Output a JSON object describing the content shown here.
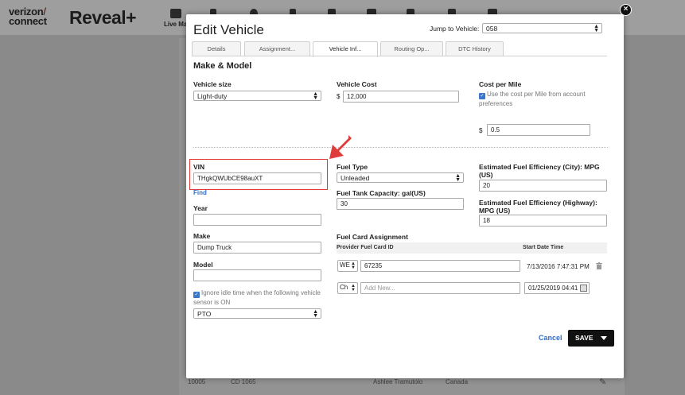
{
  "app": {
    "brand_line1": "verizon",
    "brand_tick": "/",
    "brand_line2": "connect",
    "product": "Reveal+",
    "nav_live_map": "Live Ma",
    "bg_row": {
      "id": "10005",
      "code": "CD 1065",
      "name": "Ashlee Tramutolo",
      "country": "Canada"
    }
  },
  "modal": {
    "title": "Edit Vehicle",
    "jump_label": "Jump to Vehicle:",
    "jump_value": "058",
    "tabs": [
      {
        "label": "Details"
      },
      {
        "label": "Assignment..."
      },
      {
        "label": "Vehicle Inf..."
      },
      {
        "label": "Routing Op..."
      },
      {
        "label": "DTC History"
      }
    ],
    "section_title": "Make & Model",
    "vehicle_size": {
      "label": "Vehicle size",
      "value": "Light-duty"
    },
    "vehicle_cost": {
      "label": "Vehicle Cost",
      "prefix": "$",
      "value": "12,000"
    },
    "cost_per_mile": {
      "label": "Cost per Mile",
      "checkbox_text": "Use the cost per Mile from account preferences",
      "prefix": "$",
      "value": "0.5"
    },
    "vin": {
      "label": "VIN",
      "value": "THgkQWUbCE98auXT",
      "find_link": "Find"
    },
    "year": {
      "label": "Year",
      "value": ""
    },
    "make": {
      "label": "Make",
      "value": "Dump Truck"
    },
    "model": {
      "label": "Model",
      "value": ""
    },
    "idle": {
      "checkbox_text": "Ignore idle time when the following vehicle sensor is ON",
      "sensor_value": "PTO"
    },
    "fuel_type": {
      "label": "Fuel Type",
      "value": "Unleaded"
    },
    "fuel_tank": {
      "label": "Fuel Tank Capacity: gal(US)",
      "value": "30"
    },
    "eff_city": {
      "label": "Estimated Fuel Efficiency (City): MPG (US)",
      "value": "20"
    },
    "eff_highway": {
      "label": "Estimated Fuel Efficiency (Highway): MPG (US)",
      "value": "18"
    },
    "fuel_card": {
      "label": "Fuel Card Assignment",
      "col_provider": "Provider Fuel Card ID",
      "col_start": "Start Date Time",
      "rows": [
        {
          "provider": "WE",
          "card_id": "67235",
          "start": "7/13/2016 7:47:31 PM"
        },
        {
          "provider": "Ch",
          "card_id": "",
          "placeholder": "Add New...",
          "start": "01/25/2019 04:41"
        }
      ]
    },
    "cancel_label": "Cancel",
    "save_label": "SAVE"
  },
  "colors": {
    "accent": "#2f6ec9",
    "highlight": "#e03a3a",
    "save_bg": "#111111"
  }
}
